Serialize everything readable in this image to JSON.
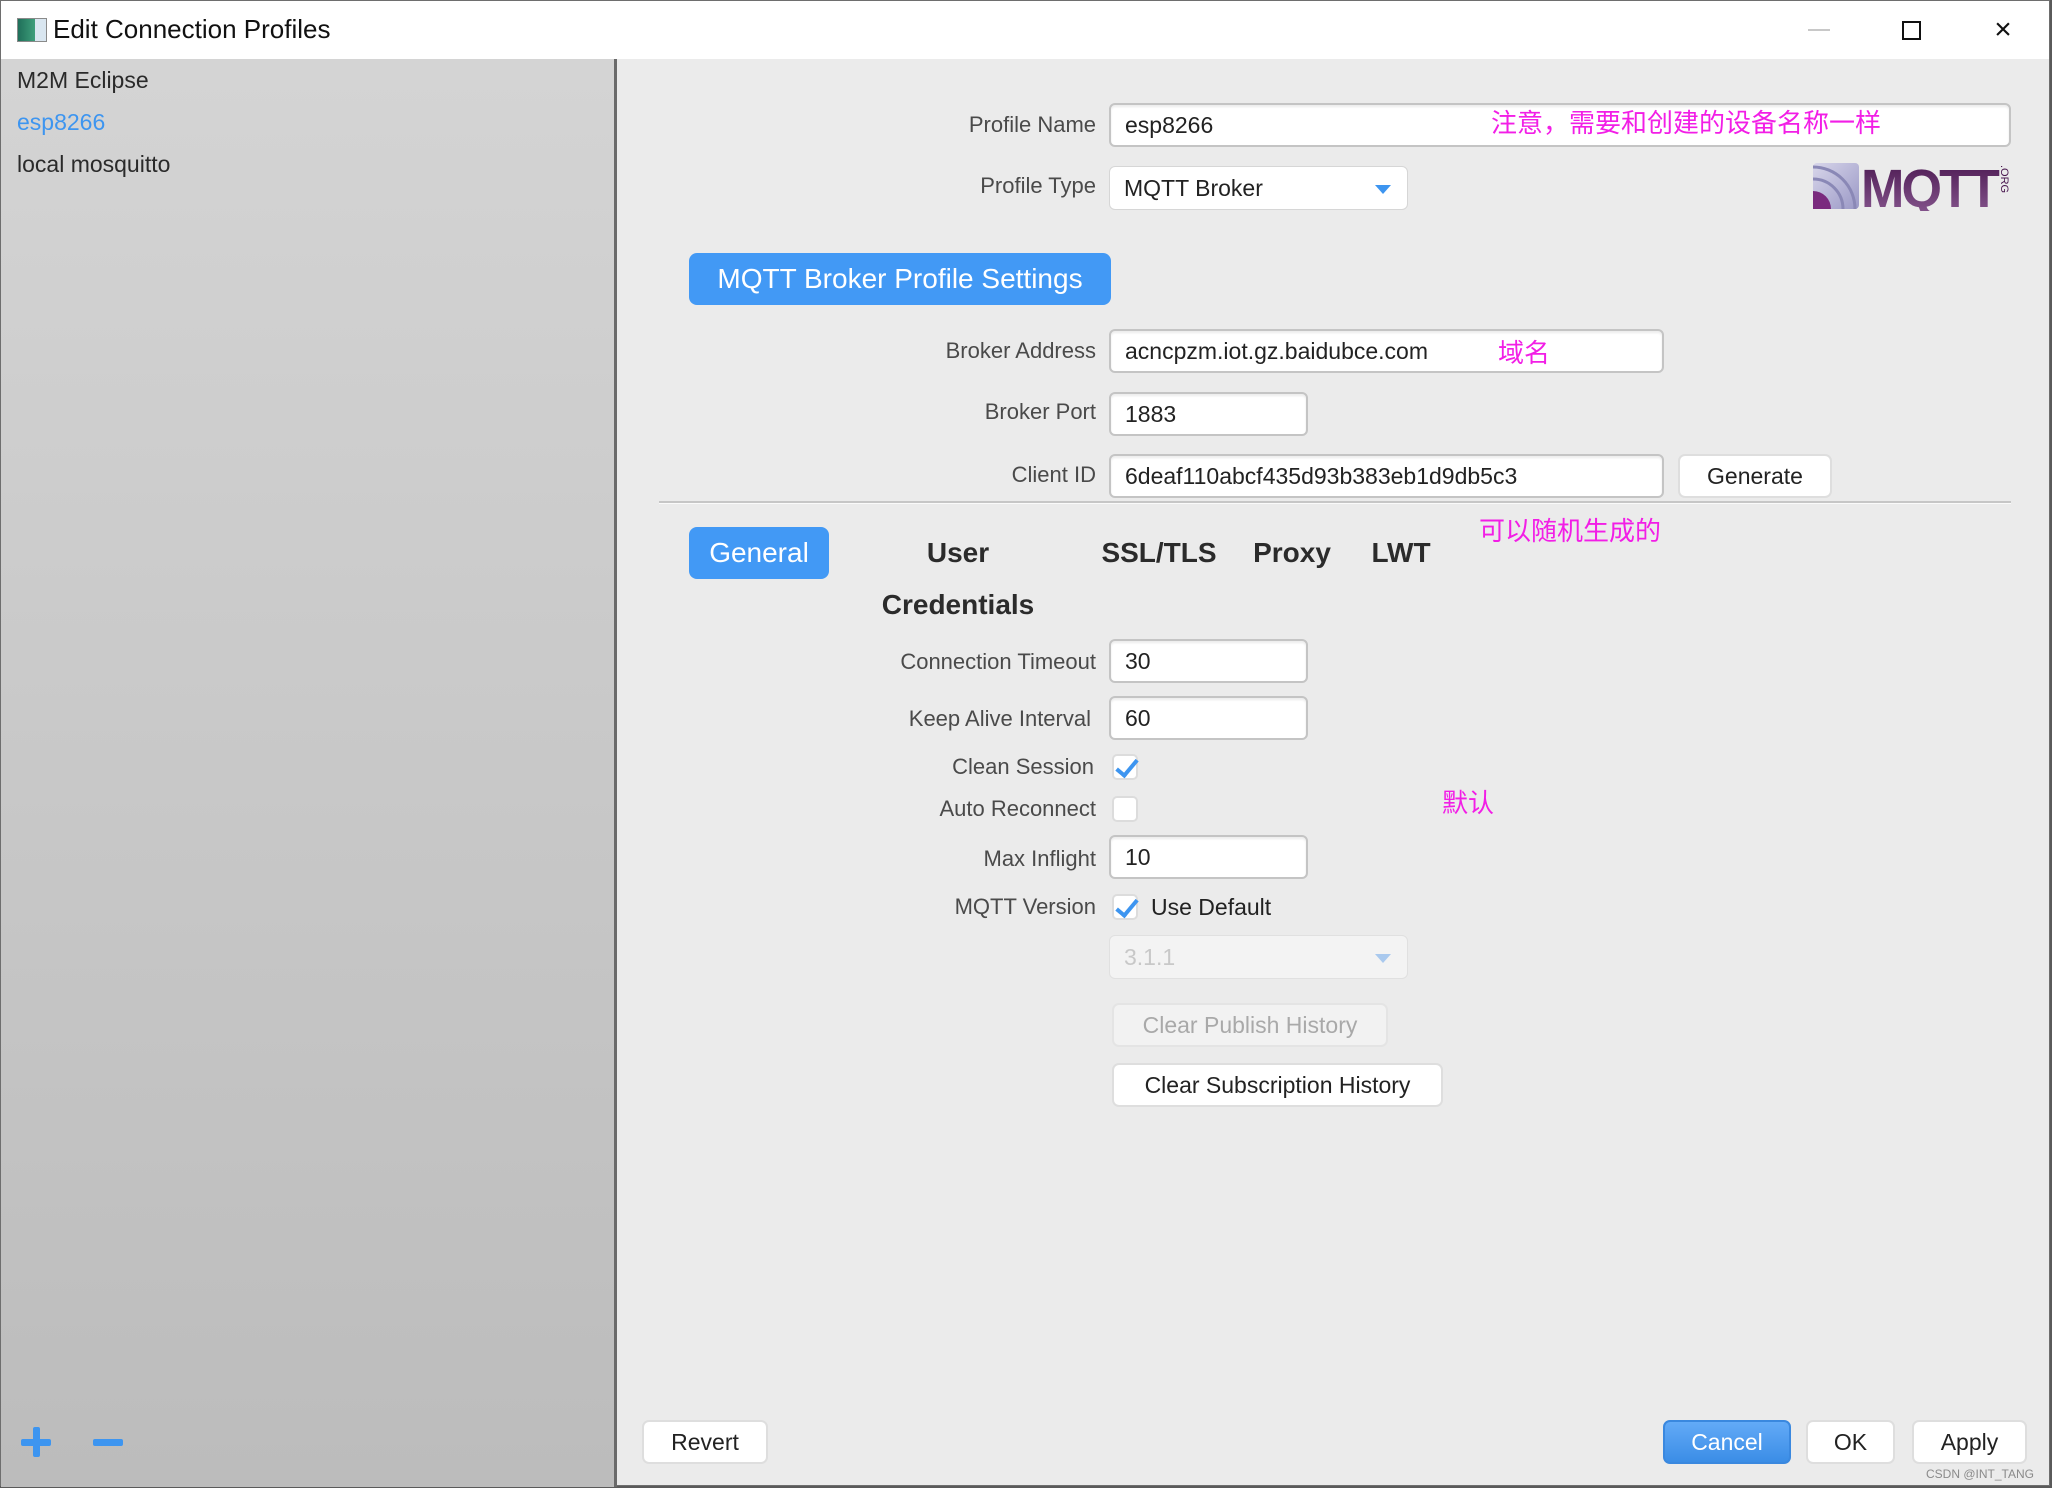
{
  "window": {
    "title": "Edit Connection Profiles",
    "icon": "app-window-icon",
    "controls": {
      "minimize": "minimize-icon",
      "maximize": "maximize-icon",
      "close": "×"
    }
  },
  "sidebar": {
    "items": [
      {
        "label": "M2M Eclipse",
        "selected": false
      },
      {
        "label": "esp8266",
        "selected": true
      },
      {
        "label": "local mosquitto",
        "selected": false
      }
    ],
    "add_icon": "plus-icon",
    "remove_icon": "minus-icon"
  },
  "profile": {
    "name_label": "Profile Name",
    "name_value": "esp8266",
    "type_label": "Profile Type",
    "type_value": "MQTT Broker",
    "logo_text": "MQTT",
    "logo_suffix": ".ORG"
  },
  "broker_settings": {
    "heading": "MQTT Broker Profile Settings",
    "address_label": "Broker Address",
    "address_value": "acncpzm.iot.gz.baidubce.com",
    "port_label": "Broker Port",
    "port_value": "1883",
    "client_id_label": "Client ID",
    "client_id_value": "6deaf110abcf435d93b383eb1d9db5c3",
    "generate_label": "Generate"
  },
  "tabs": [
    {
      "label": "General",
      "active": true
    },
    {
      "label": "User Credentials",
      "active": false
    },
    {
      "label": "SSL/TLS",
      "active": false
    },
    {
      "label": "Proxy",
      "active": false
    },
    {
      "label": "LWT",
      "active": false
    }
  ],
  "general": {
    "connection_timeout_label": "Connection Timeout",
    "connection_timeout_value": "30",
    "keep_alive_label": "Keep Alive Interval",
    "keep_alive_value": "60",
    "clean_session_label": "Clean Session",
    "clean_session_checked": true,
    "auto_reconnect_label": "Auto Reconnect",
    "auto_reconnect_checked": false,
    "max_inflight_label": "Max Inflight",
    "max_inflight_value": "10",
    "mqtt_version_label": "MQTT Version",
    "use_default_label": "Use Default",
    "use_default_checked": true,
    "version_value": "3.1.1",
    "clear_publish_label": "Clear Publish History",
    "clear_subscription_label": "Clear Subscription History"
  },
  "annotations": {
    "profile_name_note": "注意，需要和创建的设备名称一样",
    "address_note": "域名",
    "client_id_note": "可以随机生成的",
    "defaults_note": "默认"
  },
  "footer": {
    "revert_label": "Revert",
    "cancel_label": "Cancel",
    "ok_label": "OK",
    "apply_label": "Apply"
  },
  "watermark": "CSDN @INT_TANG",
  "colors": {
    "accent": "#4299f5",
    "annotation": "#f21ee6",
    "sidebar_selected": "#3d95f0"
  }
}
